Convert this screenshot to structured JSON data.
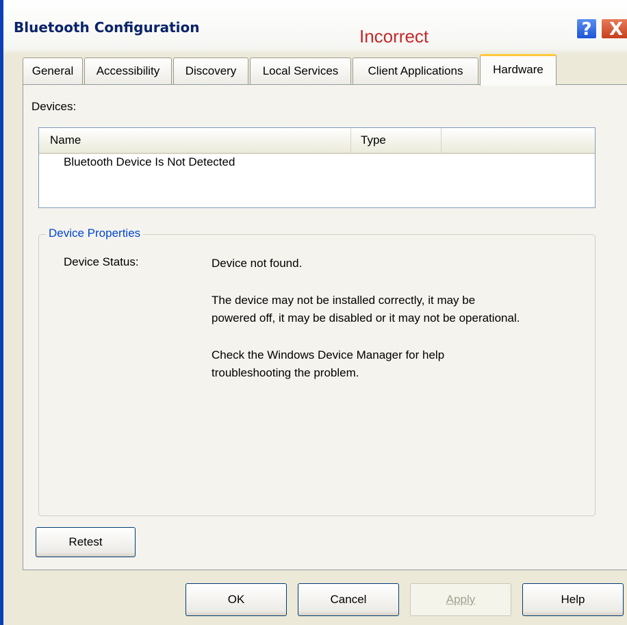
{
  "window": {
    "title": "Bluetooth Configuration",
    "watermark": "Incorrect",
    "help_button": "?",
    "close_button": "X"
  },
  "tabs": [
    {
      "label": "General"
    },
    {
      "label": "Accessibility"
    },
    {
      "label": "Discovery"
    },
    {
      "label": "Local Services"
    },
    {
      "label": "Client Applications"
    },
    {
      "label": "Hardware",
      "active": true
    }
  ],
  "devices": {
    "label": "Devices:",
    "columns": [
      "Name",
      "Type"
    ],
    "rows": [
      {
        "name": "Bluetooth Device Is Not Detected",
        "type": ""
      }
    ]
  },
  "device_properties": {
    "legend": "Device Properties",
    "status_label": "Device Status:",
    "status_value": "Device not found.",
    "message_line1": "The device may not be installed correctly, it may be",
    "message_line2": "powered off, it may be disabled or it may not be operational.",
    "help_line1": "Check the Windows Device Manager for help",
    "help_line2": "troubleshooting the problem."
  },
  "buttons": {
    "retest": "Retest",
    "ok": "OK",
    "cancel": "Cancel",
    "apply": "Apply",
    "help": "Help"
  },
  "colors": {
    "title_text": "#0a246a",
    "watermark": "#c6282a",
    "legend_text": "#0046d5",
    "active_tab_accent": "#ffc83c"
  }
}
